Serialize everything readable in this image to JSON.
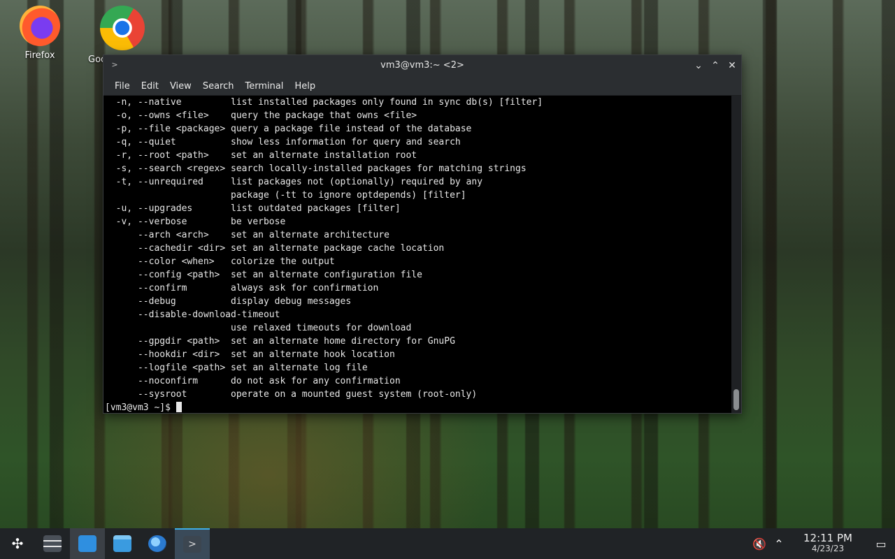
{
  "desktop": {
    "icons": [
      {
        "label": "Firefox",
        "icon": "firefox-icon"
      },
      {
        "label": "Goo",
        "icon": "chrome-icon"
      }
    ]
  },
  "window": {
    "title": "vm3@vm3:~ <2>",
    "controls": {
      "minimize": "⌄",
      "maximize": "⌃",
      "close": "✕"
    },
    "menu": [
      "File",
      "Edit",
      "View",
      "Search",
      "Terminal",
      "Help"
    ]
  },
  "terminal": {
    "lines": [
      "  -n, --native         list installed packages only found in sync db(s) [filter]",
      "  -o, --owns <file>    query the package that owns <file>",
      "  -p, --file <package> query a package file instead of the database",
      "  -q, --quiet          show less information for query and search",
      "  -r, --root <path>    set an alternate installation root",
      "  -s, --search <regex> search locally-installed packages for matching strings",
      "  -t, --unrequired     list packages not (optionally) required by any",
      "                       package (-tt to ignore optdepends) [filter]",
      "  -u, --upgrades       list outdated packages [filter]",
      "  -v, --verbose        be verbose",
      "      --arch <arch>    set an alternate architecture",
      "      --cachedir <dir> set an alternate package cache location",
      "      --color <when>   colorize the output",
      "      --config <path>  set an alternate configuration file",
      "      --confirm        always ask for confirmation",
      "      --debug          display debug messages",
      "      --disable-download-timeout",
      "                       use relaxed timeouts for download",
      "      --gpgdir <path>  set an alternate home directory for GnuPG",
      "      --hookdir <dir>  set an alternate hook location",
      "      --logfile <path> set an alternate log file",
      "      --noconfirm      do not ask for any confirmation",
      "      --sysroot        operate on a mounted guest system (root-only)"
    ],
    "prompt": "[vm3@vm3 ~]$ "
  },
  "taskbar": {
    "items": [
      {
        "name": "application-launcher-icon"
      },
      {
        "name": "settings-sliders-icon"
      },
      {
        "name": "discover-store-icon"
      },
      {
        "name": "file-manager-icon"
      },
      {
        "name": "web-browser-icon"
      },
      {
        "name": "terminal-task-icon"
      }
    ],
    "tray": {
      "clock_time": "12:11 PM",
      "clock_date": "4/23/23"
    }
  }
}
